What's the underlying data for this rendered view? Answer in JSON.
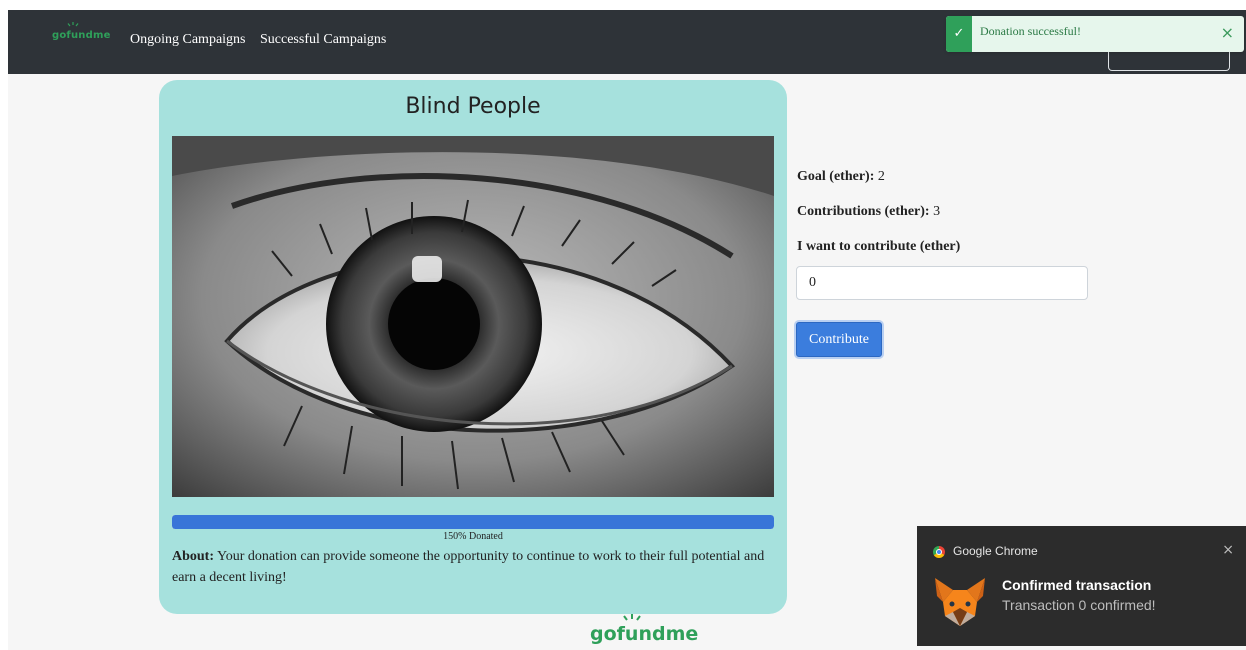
{
  "nav": {
    "brand": "gofundme",
    "links": [
      "Ongoing Campaigns",
      "Successful Campaigns"
    ]
  },
  "toast": {
    "message": "Donation successful!",
    "close": "×",
    "check": "✓"
  },
  "campaign": {
    "title": "Blind People",
    "image_icon": "eye-photo",
    "progress_percent": 150,
    "progress_label": "150% Donated",
    "about_label": "About:",
    "about_text": " Your donation can provide someone the opportunity to continue to work to their full potential and earn a decent living!"
  },
  "form": {
    "goal_label": "Goal (ether):",
    "goal_value": " 2",
    "contrib_label": "Contributions (ether):",
    "contrib_value": " 3",
    "want_label": "I want to contribute (ether)",
    "amount_value": "0",
    "contribute_button": "Contribute"
  },
  "footer": {
    "logo": "gofundme"
  },
  "notification": {
    "app": "Google Chrome",
    "close": "×",
    "title": "Confirmed transaction",
    "body": "Transaction 0 confirmed!",
    "icon": "metamask-fox-icon"
  },
  "colors": {
    "navbar": "#2e3338",
    "brand_green": "#2fa05a",
    "card_bg": "#a6e1dd",
    "progress": "#3875d8",
    "button": "#3b7ddd"
  }
}
